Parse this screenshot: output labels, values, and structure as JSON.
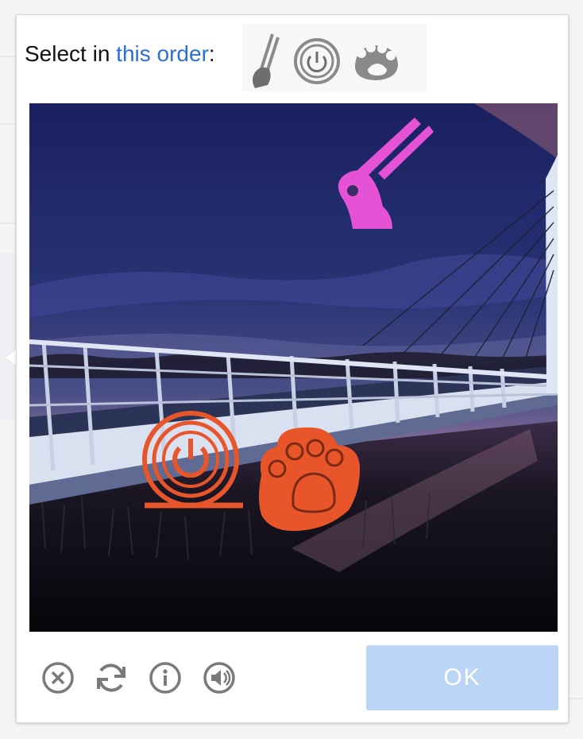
{
  "captcha": {
    "instruction_prefix": "Select in ",
    "instruction_link": "this order",
    "instruction_suffix": ":",
    "hint_icons": [
      "brush-icon",
      "power-disc-icon",
      "paw-icon"
    ],
    "image_icons": [
      "brush-icon",
      "power-disc-icon",
      "paw-icon"
    ],
    "ok_label": "OK",
    "colors": {
      "link": "#2a6fd6",
      "ok_background": "#bcd5f6",
      "brush_icon": "#e552d6",
      "orange_icons": "#e8552a",
      "control_icons": "#7a7a7a"
    }
  }
}
